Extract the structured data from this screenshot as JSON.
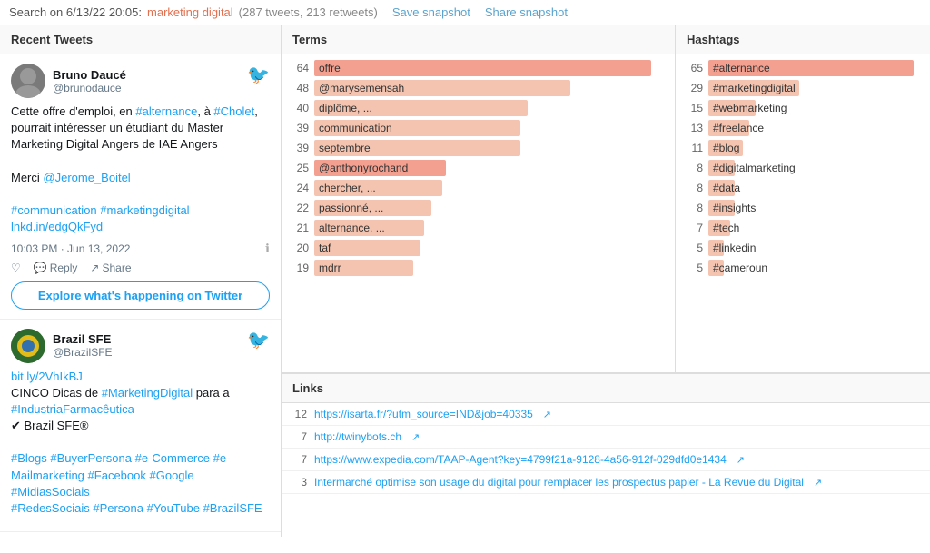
{
  "header": {
    "search_label": "Search on 6/13/22 20:05:",
    "query": "marketing digital",
    "count": "(287 tweets, 213 retweets)",
    "save_snapshot": "Save snapshot",
    "share_snapshot": "Share snapshot"
  },
  "left_panel": {
    "title": "Recent Tweets",
    "tweets": [
      {
        "id": "tweet1",
        "user_name": "Bruno Daucé",
        "user_handle": "@brunodauce",
        "body_parts": [
          {
            "type": "text",
            "content": "Cette offre d'emploi, en "
          },
          {
            "type": "hashtag",
            "content": "#alternance"
          },
          {
            "type": "text",
            "content": ", à "
          },
          {
            "type": "hashtag",
            "content": "#Cholet"
          },
          {
            "type": "text",
            "content": ", pourrait intéresser un étudiant du Master Marketing Digital Angers de IAE Angers\n\nMerci "
          },
          {
            "type": "mention",
            "content": "@Jerome_Boitel"
          }
        ],
        "hashtags_line": "#communication #marketingdigital",
        "link": "lnkd.in/edgQkFyd",
        "timestamp": "10:03 PM · Jun 13, 2022",
        "explore_btn": "Explore what's happening on Twitter"
      },
      {
        "id": "tweet2",
        "user_name": "Brazil SFE",
        "user_handle": "@BrazilSFE",
        "link_short": "bit.ly/2VhIkBJ",
        "body": "CINCO Dicas de #MarketingDigital para a #IndustriaFarmacêutica\n✔ Brazil SFE®",
        "tags": "#Blogs #BuyerPersona #e-Commerce #e-Mailmarketing #Facebook #Google #MidiasSociais #RedesSociais #Persona #YouTube #BrazilSFE"
      }
    ]
  },
  "terms_panel": {
    "title": "Terms",
    "items": [
      {
        "count": 64,
        "label": "offre",
        "width_pct": 95,
        "highlight": true
      },
      {
        "count": 48,
        "label": "@marysemensah",
        "width_pct": 72,
        "highlight": false
      },
      {
        "count": 40,
        "label": "diplôme, ...",
        "width_pct": 60,
        "highlight": false
      },
      {
        "count": 39,
        "label": "communication",
        "width_pct": 58,
        "highlight": false
      },
      {
        "count": 39,
        "label": "septembre",
        "width_pct": 58,
        "highlight": false
      },
      {
        "count": 25,
        "label": "@anthonyrochand",
        "width_pct": 37,
        "highlight": true
      },
      {
        "count": 24,
        "label": "chercher, ...",
        "width_pct": 36,
        "highlight": false
      },
      {
        "count": 22,
        "label": "passionné, ...",
        "width_pct": 33,
        "highlight": false
      },
      {
        "count": 21,
        "label": "alternance, ...",
        "width_pct": 31,
        "highlight": false
      },
      {
        "count": 20,
        "label": "taf",
        "width_pct": 30,
        "highlight": false
      },
      {
        "count": 19,
        "label": "mdrr",
        "width_pct": 28,
        "highlight": false
      }
    ]
  },
  "hashtags_panel": {
    "title": "Hashtags",
    "items": [
      {
        "count": 65,
        "label": "#alternance",
        "width_pct": 95,
        "highlight": true
      },
      {
        "count": 29,
        "label": "#marketingdigital",
        "width_pct": 42,
        "highlight": false
      },
      {
        "count": 15,
        "label": "#webmarketing",
        "width_pct": 22,
        "highlight": false
      },
      {
        "count": 13,
        "label": "#freelance",
        "width_pct": 19,
        "highlight": false
      },
      {
        "count": 11,
        "label": "#blog",
        "width_pct": 16,
        "highlight": false
      },
      {
        "count": 8,
        "label": "#digitalmarketing",
        "width_pct": 12,
        "highlight": false
      },
      {
        "count": 8,
        "label": "#data",
        "width_pct": 12,
        "highlight": false
      },
      {
        "count": 8,
        "label": "#insights",
        "width_pct": 12,
        "highlight": false
      },
      {
        "count": 7,
        "label": "#tech",
        "width_pct": 10,
        "highlight": false
      },
      {
        "count": 5,
        "label": "#linkedin",
        "width_pct": 7,
        "highlight": false
      },
      {
        "count": 5,
        "label": "#cameroun",
        "width_pct": 7,
        "highlight": false
      }
    ]
  },
  "links_panel": {
    "title": "Links",
    "items": [
      {
        "count": 12,
        "url": "https://isarta.fr/?utm_source=IND&job=40335",
        "has_icon": true
      },
      {
        "count": 7,
        "url": "http://twinybots.ch",
        "has_icon": true
      },
      {
        "count": 7,
        "url": "https://www.expedia.com/TAAP-Agent?key=4799f21a-9128-4a56-912f-029dfd0e1434",
        "has_icon": true
      },
      {
        "count": 3,
        "url": "Intermarché optimise son usage du digital pour remplacer les prospectus papier - La Revue du Digital",
        "has_icon": true
      }
    ]
  },
  "actions": {
    "like": "♡",
    "reply": "Reply",
    "share": "Share",
    "reply_icon": "💬",
    "share_icon": "↗"
  }
}
